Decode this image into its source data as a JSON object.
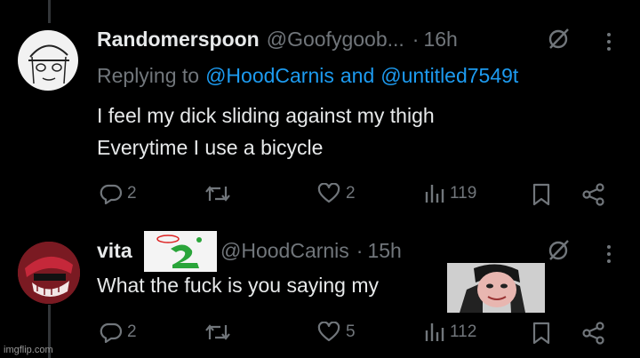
{
  "post1": {
    "display_name": "Randomerspoon",
    "handle": "@Goofygoob...",
    "time_sep": "·",
    "time": "16h",
    "replying_prefix": "Replying to",
    "replying_user1": "@HoodCarnis",
    "replying_and": "and",
    "replying_user2": "@untitled7549t",
    "text_line1": "I feel my dick sliding against my thigh",
    "text_line2": "Everytime I use a bicycle",
    "replies": "2",
    "reposts": "",
    "likes": "2",
    "views": "119"
  },
  "post2": {
    "display_name": "vita",
    "handle": "@HoodCarnis",
    "time_sep": "·",
    "time": "15h",
    "text": "What the fuck is you saying my",
    "replies": "2",
    "reposts": "",
    "likes": "5",
    "views": "112"
  },
  "colors": {
    "background": "#000000",
    "text": "#e7e9ea",
    "muted": "#71767b",
    "link": "#1d9bf0"
  },
  "icons": [
    "reply-icon",
    "repost-icon",
    "like-icon",
    "views-icon",
    "bookmark-icon",
    "share-icon",
    "grok-icon",
    "more-icon"
  ],
  "watermark": "imgflip.com"
}
